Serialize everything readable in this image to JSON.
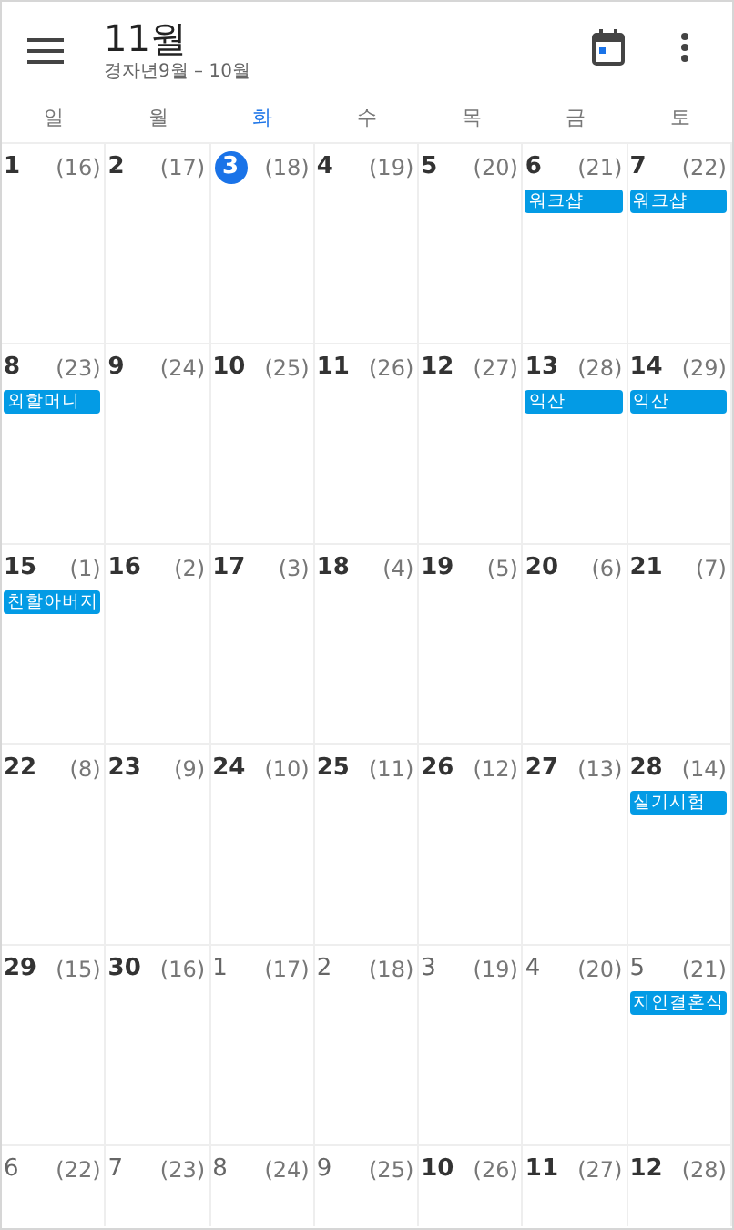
{
  "header": {
    "title": "11월",
    "subtitle": "경자년9월 – 10월"
  },
  "weekdays": [
    {
      "label": "일",
      "today": false
    },
    {
      "label": "월",
      "today": false
    },
    {
      "label": "화",
      "today": true
    },
    {
      "label": "수",
      "today": false
    },
    {
      "label": "목",
      "today": false
    },
    {
      "label": "금",
      "today": false
    },
    {
      "label": "토",
      "today": false
    }
  ],
  "weeks": [
    {
      "days": [
        {
          "date": "1",
          "lunar": "(16)",
          "today": false,
          "dimmed": false
        },
        {
          "date": "2",
          "lunar": "(17)",
          "today": false,
          "dimmed": false
        },
        {
          "date": "3",
          "lunar": "(18)",
          "today": true,
          "dimmed": false
        },
        {
          "date": "4",
          "lunar": "(19)",
          "today": false,
          "dimmed": false
        },
        {
          "date": "5",
          "lunar": "(20)",
          "today": false,
          "dimmed": false
        },
        {
          "date": "6",
          "lunar": "(21)",
          "today": false,
          "dimmed": false,
          "events": [
            "워크샵"
          ]
        },
        {
          "date": "7",
          "lunar": "(22)",
          "today": false,
          "dimmed": false,
          "events": [
            "워크샵"
          ]
        }
      ]
    },
    {
      "days": [
        {
          "date": "8",
          "lunar": "(23)",
          "today": false,
          "dimmed": false,
          "events": [
            "외할머니"
          ]
        },
        {
          "date": "9",
          "lunar": "(24)",
          "today": false,
          "dimmed": false
        },
        {
          "date": "10",
          "lunar": "(25)",
          "today": false,
          "dimmed": false
        },
        {
          "date": "11",
          "lunar": "(26)",
          "today": false,
          "dimmed": false
        },
        {
          "date": "12",
          "lunar": "(27)",
          "today": false,
          "dimmed": false
        },
        {
          "date": "13",
          "lunar": "(28)",
          "today": false,
          "dimmed": false,
          "events": [
            "익산"
          ]
        },
        {
          "date": "14",
          "lunar": "(29)",
          "today": false,
          "dimmed": false,
          "events": [
            "익산"
          ]
        }
      ]
    },
    {
      "days": [
        {
          "date": "15",
          "lunar": "(1)",
          "today": false,
          "dimmed": false,
          "events": [
            "친할아버지"
          ]
        },
        {
          "date": "16",
          "lunar": "(2)",
          "today": false,
          "dimmed": false
        },
        {
          "date": "17",
          "lunar": "(3)",
          "today": false,
          "dimmed": false
        },
        {
          "date": "18",
          "lunar": "(4)",
          "today": false,
          "dimmed": false
        },
        {
          "date": "19",
          "lunar": "(5)",
          "today": false,
          "dimmed": false
        },
        {
          "date": "20",
          "lunar": "(6)",
          "today": false,
          "dimmed": false
        },
        {
          "date": "21",
          "lunar": "(7)",
          "today": false,
          "dimmed": false
        }
      ]
    },
    {
      "days": [
        {
          "date": "22",
          "lunar": "(8)",
          "today": false,
          "dimmed": false
        },
        {
          "date": "23",
          "lunar": "(9)",
          "today": false,
          "dimmed": false
        },
        {
          "date": "24",
          "lunar": "(10)",
          "today": false,
          "dimmed": false
        },
        {
          "date": "25",
          "lunar": "(11)",
          "today": false,
          "dimmed": false
        },
        {
          "date": "26",
          "lunar": "(12)",
          "today": false,
          "dimmed": false
        },
        {
          "date": "27",
          "lunar": "(13)",
          "today": false,
          "dimmed": false
        },
        {
          "date": "28",
          "lunar": "(14)",
          "today": false,
          "dimmed": false,
          "events": [
            "실기시험"
          ]
        }
      ]
    },
    {
      "days": [
        {
          "date": "29",
          "lunar": "(15)",
          "today": false,
          "dimmed": false
        },
        {
          "date": "30",
          "lunar": "(16)",
          "today": false,
          "dimmed": false
        },
        {
          "date": "1",
          "lunar": "(17)",
          "today": false,
          "dimmed": true
        },
        {
          "date": "2",
          "lunar": "(18)",
          "today": false,
          "dimmed": true
        },
        {
          "date": "3",
          "lunar": "(19)",
          "today": false,
          "dimmed": true
        },
        {
          "date": "4",
          "lunar": "(20)",
          "today": false,
          "dimmed": true
        },
        {
          "date": "5",
          "lunar": "(21)",
          "today": false,
          "dimmed": true,
          "events": [
            "지인결혼식"
          ]
        }
      ]
    },
    {
      "days": [
        {
          "date": "6",
          "lunar": "(22)",
          "today": false,
          "dimmed": true
        },
        {
          "date": "7",
          "lunar": "(23)",
          "today": false,
          "dimmed": true
        },
        {
          "date": "8",
          "lunar": "(24)",
          "today": false,
          "dimmed": true
        },
        {
          "date": "9",
          "lunar": "(25)",
          "today": false,
          "dimmed": true
        },
        {
          "date": "10",
          "lunar": "(26)",
          "today": false,
          "dimmed": false
        },
        {
          "date": "11",
          "lunar": "(27)",
          "today": false,
          "dimmed": false
        },
        {
          "date": "12",
          "lunar": "(28)",
          "today": false,
          "dimmed": false
        }
      ]
    }
  ]
}
